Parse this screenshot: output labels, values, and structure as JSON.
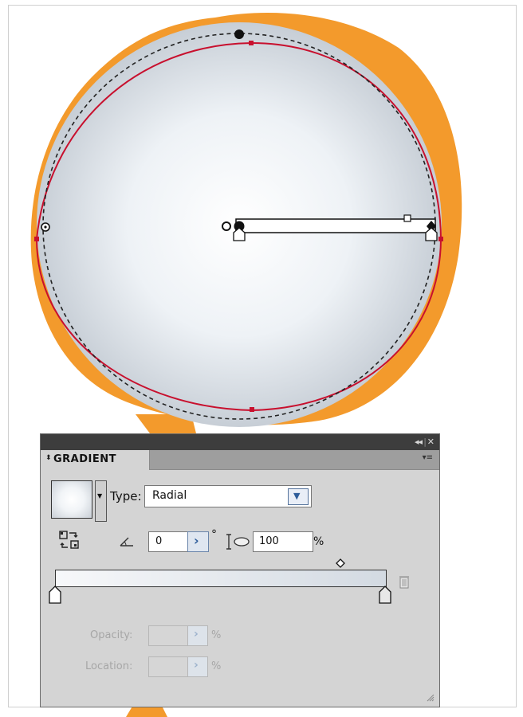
{
  "panel": {
    "tab_label": "GRADIENT",
    "collapse_symbol": "◂◂",
    "close_symbol": "✕",
    "menu_symbol": "▾≡",
    "type_label": "Type:",
    "type_value": "Radial",
    "angle_value": "0",
    "degree_symbol": "°",
    "aspect_value": "100",
    "aspect_unit": "%",
    "opacity_label": "Opacity:",
    "opacity_unit": "%",
    "location_label": "Location:",
    "location_unit": "%",
    "icons": [
      "reverse-gradient-icon",
      "angle-icon",
      "aspect-ratio-icon",
      "gradient-stop-icon",
      "midpoint-diamond-icon",
      "trash-icon",
      "resize-grip-icon"
    ]
  },
  "artwork": {
    "gradient_type": "radial",
    "gradient_from": "#ffffff",
    "gradient_to": "#c9cfd6",
    "accent_orange": "#f39a2c",
    "path_red": "#c8102e"
  }
}
